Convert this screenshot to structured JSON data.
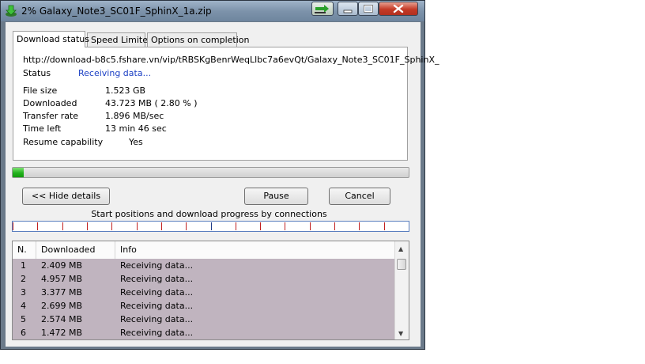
{
  "window": {
    "title": "2% Galaxy_Note3_SC01F_SphinX_1a.zip",
    "icon": "download-arrow-icon"
  },
  "tabs": [
    {
      "label": "Download status"
    },
    {
      "label": "Speed Limiter"
    },
    {
      "label": "Options on completion"
    }
  ],
  "status": {
    "url": "http://download-b8c5.fshare.vn/vip/tRBSKgBenrWeqLlbc7a6evQt/Galaxy_Note3_SC01F_SphinX_",
    "status_label": "Status",
    "status_value": "Receiving data...",
    "file_size_label": "File size",
    "file_size_value": "1.523  GB",
    "downloaded_label": "Downloaded",
    "downloaded_value": "43.723  MB  ( 2.80 % )",
    "transfer_rate_label": "Transfer rate",
    "transfer_rate_value": "1.896  MB/sec",
    "time_left_label": "Time left",
    "time_left_value": "13 min 46 sec",
    "resume_label": "Resume capability",
    "resume_value": "Yes"
  },
  "progress": {
    "percent": 2.8
  },
  "buttons": {
    "hide_details": "<< Hide details",
    "pause": "Pause",
    "cancel": "Cancel"
  },
  "connections": {
    "caption": "Start positions and download progress by connections",
    "segments": 16
  },
  "list": {
    "headers": [
      "N.",
      "Downloaded",
      "Info"
    ],
    "rows": [
      {
        "n": "1",
        "downloaded": "2.409  MB",
        "info": "Receiving data..."
      },
      {
        "n": "2",
        "downloaded": "4.957  MB",
        "info": "Receiving data..."
      },
      {
        "n": "3",
        "downloaded": "3.377  MB",
        "info": "Receiving data..."
      },
      {
        "n": "4",
        "downloaded": "2.699  MB",
        "info": "Receiving data..."
      },
      {
        "n": "5",
        "downloaded": "2.574  MB",
        "info": "Receiving data..."
      },
      {
        "n": "6",
        "downloaded": "1.472  MB",
        "info": "Receiving data..."
      }
    ]
  },
  "colors": {
    "status_text": "#1b3fc4",
    "progress_fill": "#22b11c",
    "row_background": "#c0b4bf",
    "marker_red": "#c02020"
  }
}
